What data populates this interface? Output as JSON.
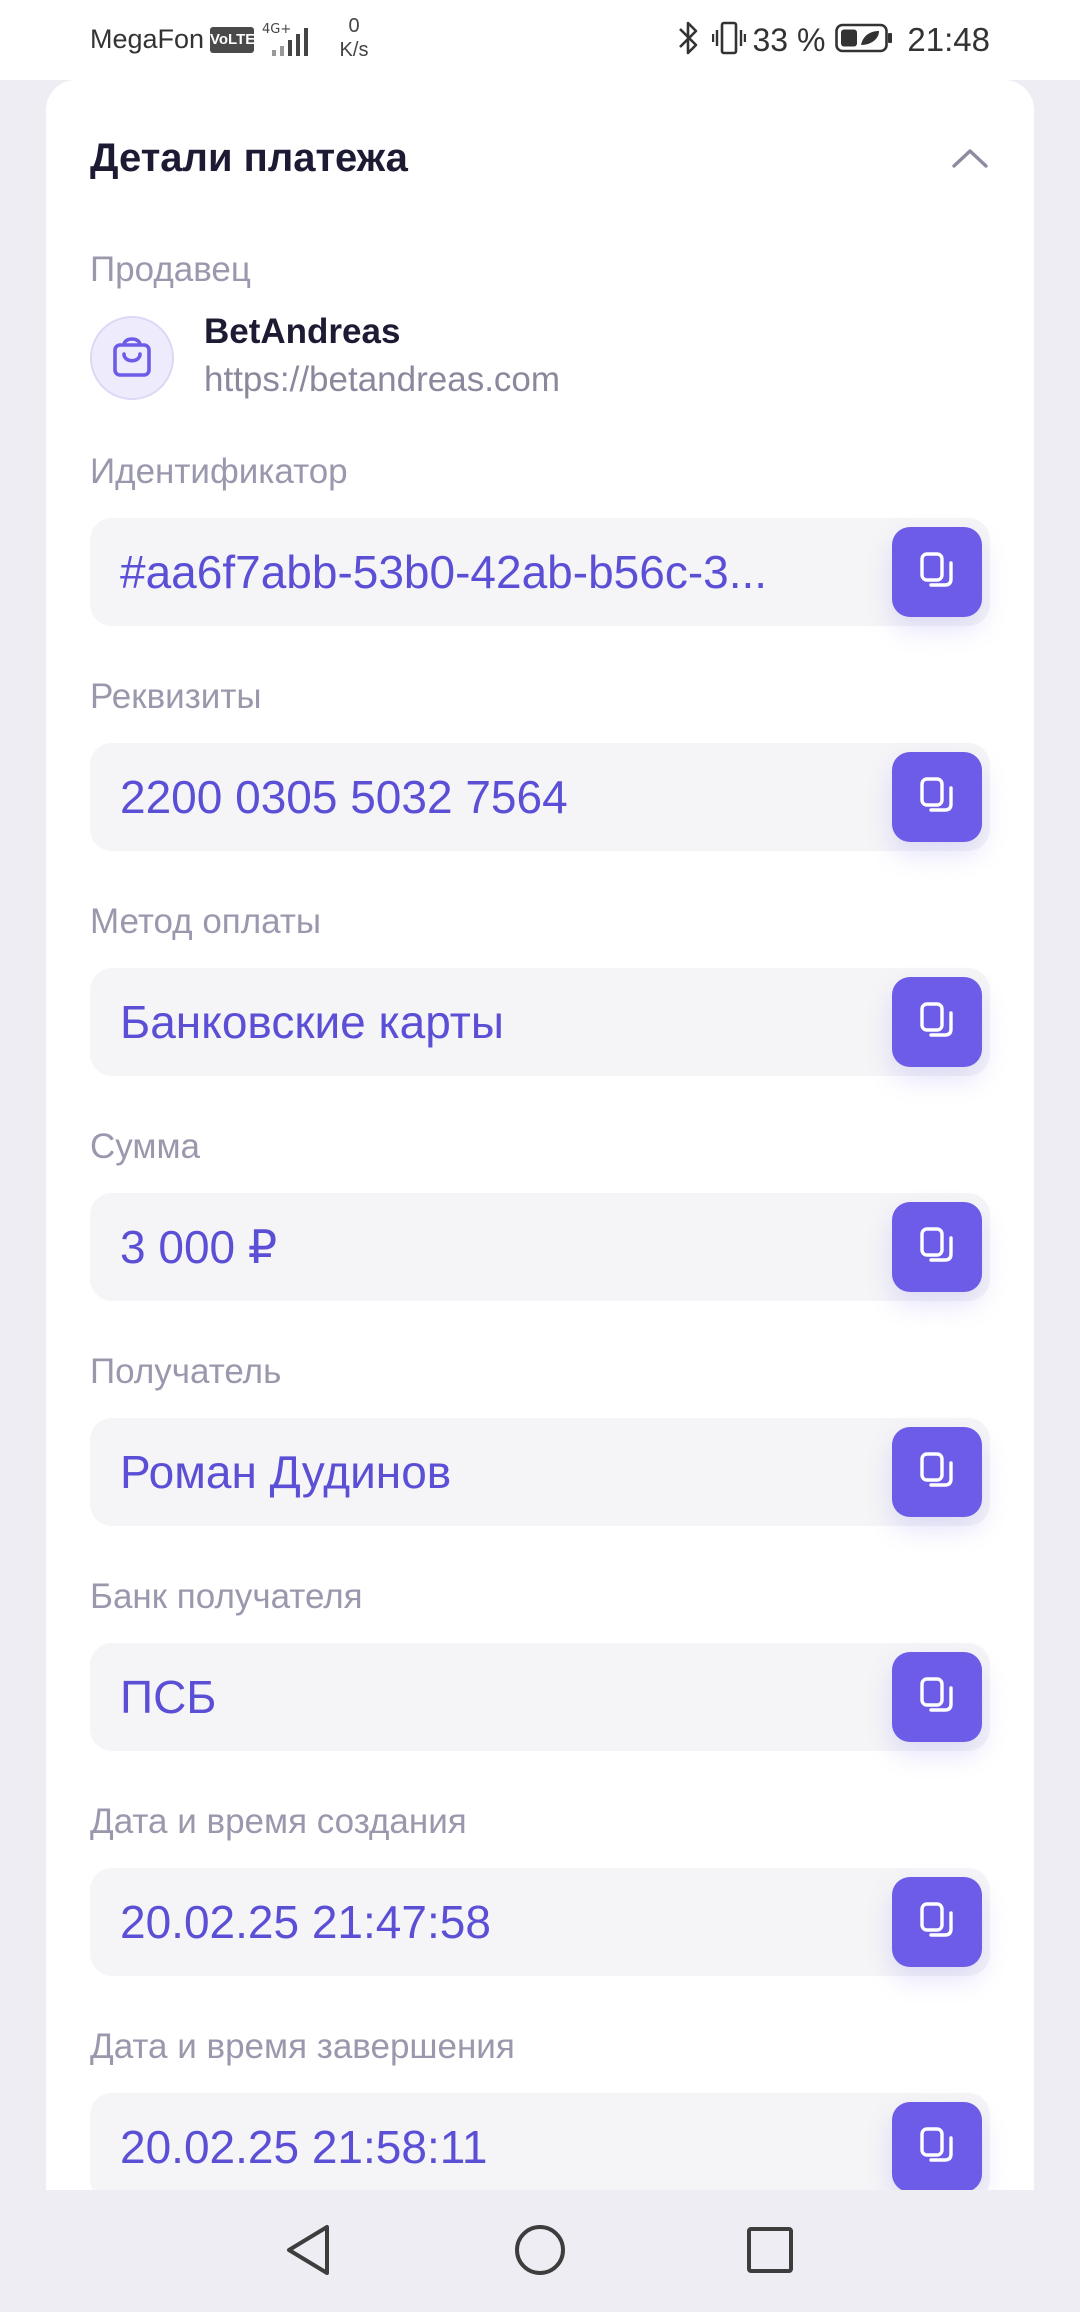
{
  "status_bar": {
    "carrier": "MegaFon",
    "volte": "VoLTE",
    "network": "4G+",
    "speed_value": "0",
    "speed_unit": "K/s",
    "battery": "33 %",
    "time": "21:48"
  },
  "card": {
    "title": "Детали платежа",
    "seller": {
      "label": "Продавец",
      "name": "BetAndreas",
      "url": "https://betandreas.com"
    },
    "fields": [
      {
        "label": "Идентификатор",
        "value": "#aa6f7abb-53b0-42ab-b56c-3..."
      },
      {
        "label": "Реквизиты",
        "value": "2200 0305 5032 7564"
      },
      {
        "label": "Метод оплаты",
        "value": "Банковские карты"
      },
      {
        "label": "Сумма",
        "value": "3 000 ₽"
      },
      {
        "label": "Получатель",
        "value": "Роман Дудинов"
      },
      {
        "label": "Банк получателя",
        "value": "ПСБ"
      },
      {
        "label": "Дата и время создания",
        "value": "20.02.25 21:47:58"
      },
      {
        "label": "Дата и время завершения",
        "value": "20.02.25 21:58:11"
      }
    ]
  },
  "icons": {
    "collapse": "chevron-up-icon",
    "seller": "shopping-bag-icon",
    "copy": "copy-icon",
    "nav_back": "back-triangle-icon",
    "nav_home": "home-circle-icon",
    "nav_recents": "recents-square-icon"
  },
  "colors": {
    "accent": "#6c5ce7",
    "value_text": "#5b4fd6",
    "label_text": "#9a98ad",
    "title_text": "#1d1b33",
    "field_bg": "#f5f5f7",
    "page_bg": "#eeedf3"
  }
}
